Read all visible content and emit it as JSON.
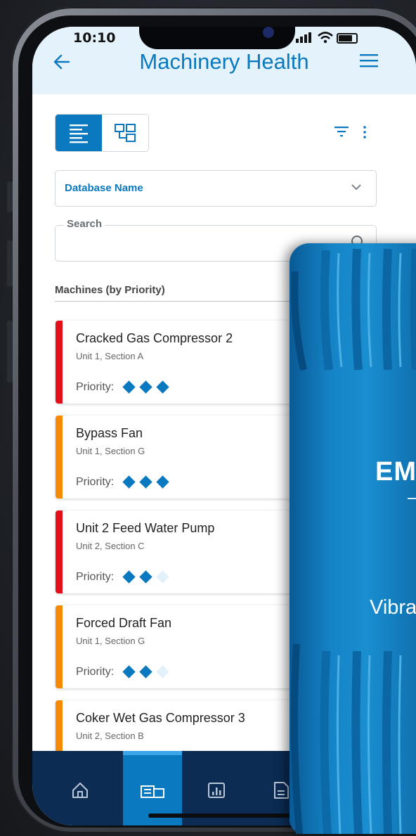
{
  "status_bar": {
    "time": "10:10"
  },
  "header": {
    "title": "Machinery Health"
  },
  "toolbar": {
    "view_modes": [
      "list",
      "tree"
    ],
    "active_view": "list"
  },
  "database_select": {
    "label": "Database Name"
  },
  "search": {
    "label": "Search",
    "value": ""
  },
  "machines_section": {
    "title": "Machines (by Priority)"
  },
  "machines": [
    {
      "name": "Cracked Gas Compressor 2",
      "location": "Unit 1, Section A",
      "priority_label": "Priority:",
      "priority": 3,
      "status_color": "#e3101b"
    },
    {
      "name": "Bypass Fan",
      "location": "Unit 1, Section G",
      "priority_label": "Priority:",
      "priority": 3,
      "status_color": "#f58a07"
    },
    {
      "name": "Unit 2 Feed Water Pump",
      "location": "Unit 2, Section C",
      "priority_label": "Priority:",
      "priority": 2,
      "status_color": "#e3101b"
    },
    {
      "name": "Forced Draft Fan",
      "location": "Unit 1, Section G",
      "priority_label": "Priority:",
      "priority": 2,
      "status_color": "#f58a07"
    },
    {
      "name": "Coker Wet Gas Compressor 3",
      "location": "Unit 2, Section B",
      "priority_label": "",
      "priority": 0,
      "status_color": "#f58a07"
    }
  ],
  "bottom_nav": {
    "items": [
      "home-icon",
      "machines-icon",
      "reports-icon",
      "document-icon"
    ],
    "active": 1
  },
  "device": {
    "brand": "EM",
    "label": "Vibra"
  },
  "colors": {
    "accent": "#0a79c0",
    "nav_bg": "#0c2c54",
    "header_bg": "#e4f2fb"
  }
}
